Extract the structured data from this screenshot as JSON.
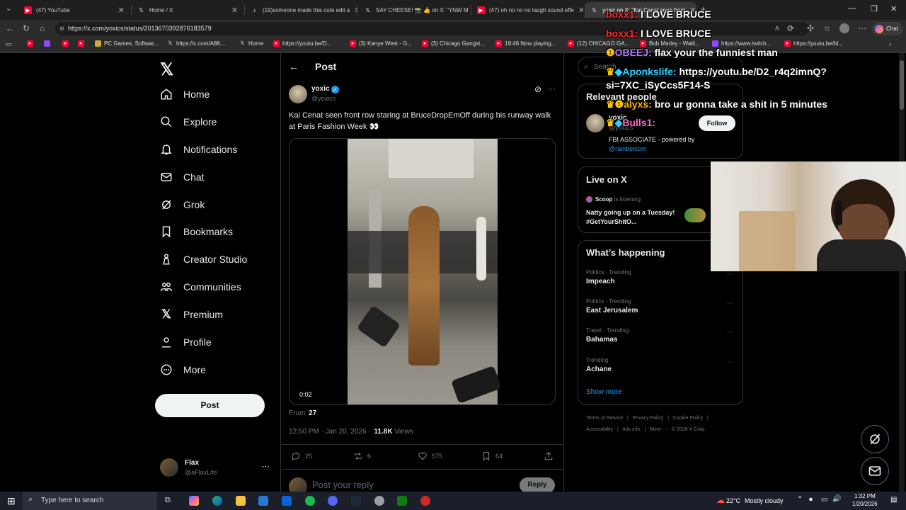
{
  "browser": {
    "tabs": [
      {
        "label": "(47) YouTube",
        "favicon": "youtube-icon",
        "color": "#ff0033"
      },
      {
        "label": "Home / X",
        "favicon": "x-icon",
        "color": "#000000"
      },
      {
        "label": "(19)someone made this cute edit a",
        "favicon": "tiktok-icon",
        "color": "#000000"
      },
      {
        "label": "SAY CHEESE! 📸 👍 on X: \"YNW M",
        "favicon": "x-icon",
        "color": "#000000"
      },
      {
        "label": "(47) oh no no no laugh sound effe",
        "favicon": "youtube-icon",
        "color": "#ff0033"
      },
      {
        "label": "yoxic on X: \"Kai Cenat seen front",
        "favicon": "x-icon",
        "color": "#000000"
      }
    ],
    "url": "https://x.com/yoxics/status/2013670392876183579",
    "bookmarks": [
      "",
      "",
      "",
      "PC Games, Softwar...",
      "https://x.com/A88...",
      "Home",
      "https://youtu.be/D...",
      "(3) Kanye West - G...",
      "(3) Chicago Gangst...",
      "19:46 Now playing...",
      "(12) CHICAGO GA...",
      "Bob Marley - Waiti...",
      "https://www.twitch...",
      "https://youtu.be/bl..."
    ],
    "chat_button": "Chat"
  },
  "sidebar": {
    "items": [
      {
        "label": "Home",
        "icon": "home-icon"
      },
      {
        "label": "Explore",
        "icon": "search-icon"
      },
      {
        "label": "Notifications",
        "icon": "bell-icon"
      },
      {
        "label": "Chat",
        "icon": "mail-icon"
      },
      {
        "label": "Grok",
        "icon": "grok-icon"
      },
      {
        "label": "Bookmarks",
        "icon": "bookmark-icon"
      },
      {
        "label": "Creator Studio",
        "icon": "creator-icon"
      },
      {
        "label": "Communities",
        "icon": "communities-icon"
      },
      {
        "label": "Premium",
        "icon": "x-premium-icon"
      },
      {
        "label": "Profile",
        "icon": "profile-icon"
      },
      {
        "label": "More",
        "icon": "more-icon"
      }
    ],
    "post_label": "Post",
    "account": {
      "name": "Flax",
      "handle": "@aFlaxLife"
    }
  },
  "post": {
    "header": "Post",
    "author_name": "yoxic",
    "author_handle": "@yoxics",
    "text": "Kai Cenat seen front row staring at BruceDropEmOff during his runway walk at Paris Fashion Week 👀",
    "video_time": "0:02",
    "from_label": "From",
    "from_value": "27",
    "timestamp": "12:50 PM · Jan 20, 2026 ·",
    "views": "11.8K",
    "views_label": "Views",
    "stats": {
      "replies": "25",
      "reposts": "6",
      "likes": "575",
      "bookmarks": "64"
    },
    "reply_placeholder": "Post your reply",
    "reply_button": "Reply"
  },
  "right": {
    "search_placeholder": "Search",
    "relevant_title": "Relevant people",
    "relevant_person": {
      "name": "yoxic",
      "handle": "@yoxics",
      "bio": "FBI ASSOCIATE - powered by",
      "link": "@rainbetcom",
      "follow": "Follow"
    },
    "live_title": "Live on X",
    "live_host": "Scoop",
    "live_status": "is listening",
    "live_text": "Natty going up on a Tuesday! #GetYourShitO...",
    "happening_title": "What’s happening",
    "trends": [
      {
        "category": "Politics · Trending",
        "name": "Impeach"
      },
      {
        "category": "Politics · Trending",
        "name": "East Jerusalem"
      },
      {
        "category": "Travel · Trending",
        "name": "Bahamas"
      },
      {
        "category": "Trending",
        "name": "Achane"
      }
    ],
    "show_more": "Show more",
    "footer": [
      "Terms of Service",
      "|",
      "Privacy Policy",
      "|",
      "Cookie Policy",
      "|",
      "Accessibility",
      "|",
      "Ads info",
      "|",
      "More ···",
      "© 2026 X Corp."
    ]
  },
  "stream_chat": [
    {
      "user": "boxx1:",
      "msg": "I LOVE BRUCE",
      "color": "#ff2a2a"
    },
    {
      "user": "boxx1:",
      "msg": "I LOVE BRUCE",
      "color": "#ff2a2a"
    },
    {
      "user": "OBEEJ:",
      "msg": "flax your the funniest man",
      "color": "#b57cff"
    },
    {
      "user": "Aponkslife:",
      "msg": "https://youtu.be/D2_r4q2imnQ?",
      "color": "#2fd0ff"
    },
    {
      "user": "",
      "msg": "si=7XC_iSyCcs5F14-S",
      "color": "#ffffff"
    },
    {
      "user": "alyxs:",
      "msg": "bro ur gonna take a shit in 5 minutes",
      "color": "#ffb000"
    },
    {
      "user": "Bulls1:",
      "msg": "",
      "color": "#ff66cc"
    }
  ],
  "taskbar": {
    "search_placeholder": "Type here to search",
    "temperature": "22°C",
    "weather": "Mostly cloudy",
    "time": "1:32 PM",
    "date": "1/20/2026"
  }
}
